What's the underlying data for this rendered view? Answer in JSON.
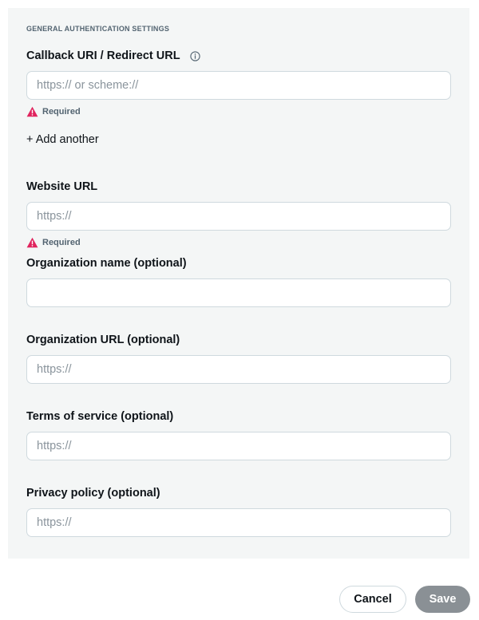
{
  "section": {
    "title": "GENERAL AUTHENTICATION SETTINGS"
  },
  "callback": {
    "label": "Callback URI / Redirect URL",
    "info_icon": "info-icon",
    "placeholder": "https:// or scheme://",
    "value": "",
    "error": "Required",
    "add_another": "+ Add another"
  },
  "website": {
    "label": "Website URL",
    "placeholder": "https://",
    "value": "",
    "error": "Required"
  },
  "organization_name": {
    "label": "Organization name (optional)",
    "placeholder": "",
    "value": ""
  },
  "organization_url": {
    "label": "Organization URL (optional)",
    "placeholder": "https://",
    "value": ""
  },
  "terms": {
    "label": "Terms of service (optional)",
    "placeholder": "https://",
    "value": ""
  },
  "privacy": {
    "label": "Privacy policy (optional)",
    "placeholder": "https://",
    "value": ""
  },
  "actions": {
    "cancel_label": "Cancel",
    "save_label": "Save"
  },
  "colors": {
    "panel_background": "#f4f6f6",
    "error_icon": "#e0245e",
    "save_disabled": "#8a9095",
    "border": "#cfd9de"
  }
}
